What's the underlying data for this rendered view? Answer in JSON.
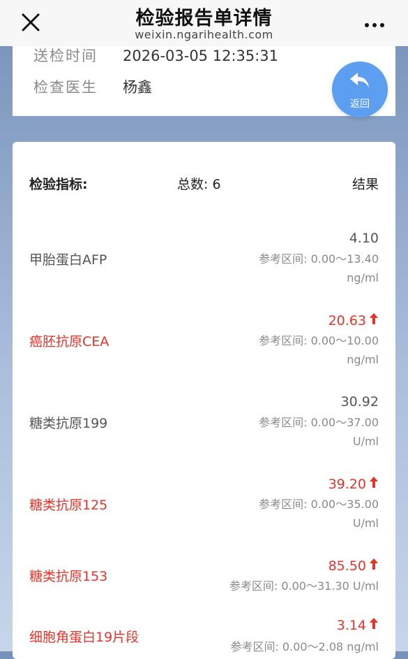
{
  "nav": {
    "title": "检验报告单详情",
    "subtitle": "weixin.ngarihealth.com"
  },
  "info": {
    "send_time_label": "送检时间",
    "send_time_value": "2026-03-05 12:35:31",
    "doctor_label": "检查医生",
    "doctor_value": "杨鑫"
  },
  "back_button": {
    "label": "返回"
  },
  "results": {
    "header_label": "检验指标:",
    "total_label": "总数:",
    "total_value": "6",
    "result_label": "结果",
    "ref_prefix": "参考区间:",
    "items": [
      {
        "name": "甲胎蛋白AFP",
        "value": "4.10",
        "ref": "0.00～13.40",
        "unit": "ng/ml",
        "abnormal": false
      },
      {
        "name": "癌胚抗原CEA",
        "value": "20.63",
        "ref": "0.00～10.00",
        "unit": "ng/ml",
        "abnormal": true
      },
      {
        "name": "糖类抗原199",
        "value": "30.92",
        "ref": "0.00～37.00",
        "unit": "U/ml",
        "abnormal": false
      },
      {
        "name": "糖类抗原125",
        "value": "39.20",
        "ref": "0.00～35.00",
        "unit": "U/ml",
        "abnormal": true
      },
      {
        "name": "糖类抗原153",
        "value": "85.50",
        "ref": "0.00～31.30",
        "unit": "U/ml",
        "abnormal": true
      },
      {
        "name": "细胞角蛋白19片段",
        "value": "3.14",
        "ref": "0.00～2.08",
        "unit": "ng/ml",
        "abnormal": true
      }
    ]
  },
  "colors": {
    "abnormal": "#e8332b",
    "accent": "#5c9ef0"
  },
  "icons": {
    "close": "close-icon",
    "more": "more-icon",
    "back": "reply-arrow-icon",
    "up_arrow": "arrow-up-icon"
  }
}
